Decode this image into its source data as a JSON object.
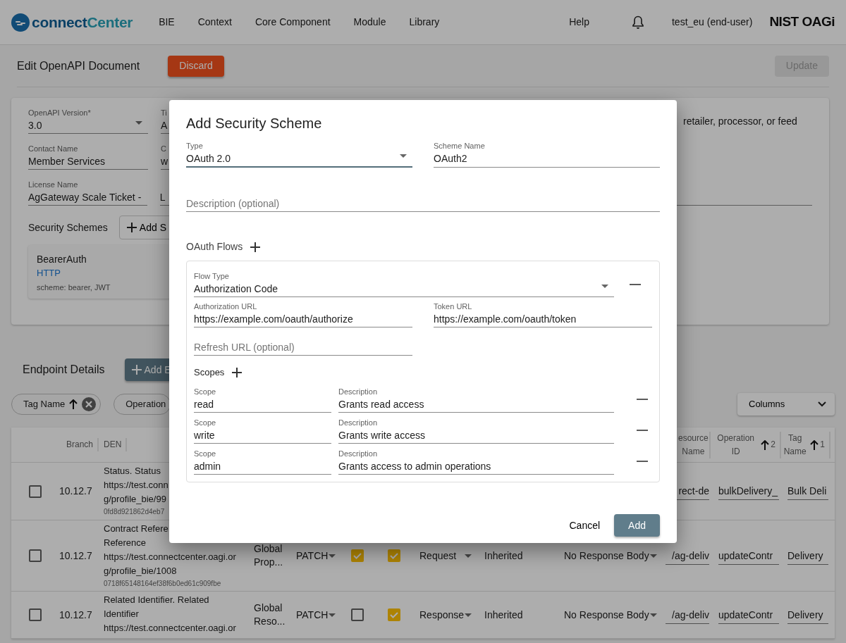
{
  "navbar": {
    "brand": {
      "part_1": "connect",
      "part_2": "Center"
    },
    "menu": [
      {
        "label": "BIE"
      },
      {
        "label": "Context"
      },
      {
        "label": "Core Component"
      },
      {
        "label": "Module"
      },
      {
        "label": "Library"
      }
    ],
    "help": "Help",
    "user": "test_eu (end-user)",
    "org_logo": "NIST OAGi"
  },
  "toolbar": {
    "title": "Edit OpenAPI Document",
    "discard_button": "Discard",
    "update_button": {
      "label": "Update",
      "disabled": true
    }
  },
  "document_form": {
    "rows": [
      [
        {
          "label": "OpenAPI Version*",
          "value": "3.0",
          "kind": "select"
        },
        {
          "label": "Ti",
          "value": "A",
          "kind": "text"
        }
      ],
      [
        {
          "label": "Contact Name",
          "value": "Member Services",
          "kind": "text"
        },
        {
          "label": "C",
          "value": "w",
          "kind": "text"
        }
      ],
      [
        {
          "label": "License Name",
          "value": "AgGateway Scale Ticket -",
          "kind": "text"
        },
        {
          "value": "L",
          "kind": "text"
        }
      ]
    ],
    "description_excerpt": "retailer, processor, or feed"
  },
  "security_schemes": {
    "label": "Security Schemes",
    "add_button": "Add S",
    "schemes": [
      {
        "name": "BearerAuth",
        "type": "HTTP",
        "details": "scheme: bearer, JWT"
      }
    ]
  },
  "endpoints": {
    "title": "Endpoint Details",
    "add_button": "Add E",
    "sort_chips": [
      {
        "label": "Tag Name",
        "ascending": true,
        "removable": true
      },
      {
        "label": "Operation"
      }
    ],
    "columns_button": "Columns",
    "table": {
      "columns": {
        "branch": {
          "label": "Branch"
        },
        "den": {
          "label": "DEN"
        },
        "resource_name": {
          "label": "esource Name"
        },
        "operation_id": {
          "label": "Operation ID",
          "ascending": true,
          "sort_order": "2"
        },
        "tag_name": {
          "label": "Tag Name",
          "ascending": true,
          "sort_order": "1"
        }
      },
      "rows": [
        {
          "selected": false,
          "branch": "10.12.7",
          "den": [
            "Status. Status",
            "https://test.conn",
            "g/profile_bie/99"
          ],
          "den_id": "0fd8d921862d4eb7",
          "resource_name": "rect-de",
          "operation_id": "bulkDelivery_",
          "tag_name": "Bulk Deli"
        },
        {
          "selected": false,
          "branch": "10.12.7",
          "den": [
            "Contract Refere",
            "Reference",
            "https://test.connectcenter.oagi.or",
            "g/profile_bie/1008"
          ],
          "den_id": "0718f65148164ef38f6b0ed61c909fbe",
          "component": "Global Prop...",
          "method": "PATCH",
          "flag_1": true,
          "flag_2": true,
          "message_type": "Request",
          "inheritance": "Inherited",
          "response_body": "No Response Body",
          "resource_name": "/ag-deliv",
          "operation_id": "updateContr",
          "tag_name": "Delivery"
        },
        {
          "selected": false,
          "branch": "10.12.7",
          "den": [
            "Related Identifier. Related",
            "Identifier",
            "https://test.connectcenter.oagi.or"
          ],
          "component": "Global Reso...",
          "method": "PATCH",
          "flag_1": false,
          "flag_2": true,
          "message_type": "Response",
          "inheritance": "Inherited",
          "response_body": "No Response Body",
          "resource_name": "/ag-deliv",
          "operation_id": "updateContr",
          "tag_name": "Delivery"
        }
      ]
    }
  },
  "dialog": {
    "title": "Add Security Scheme",
    "type": {
      "label": "Type",
      "value": "OAuth 2.0"
    },
    "scheme_name": {
      "label": "Scheme Name",
      "value": "OAuth2"
    },
    "description": {
      "placeholder": "Description (optional)"
    },
    "flows_label": "OAuth Flows",
    "flows": [
      {
        "flow_type": {
          "label": "Flow Type",
          "value": "Authorization Code"
        },
        "authorization_url": {
          "label": "Authorization URL",
          "value": "https://example.com/oauth/authorize"
        },
        "token_url": {
          "label": "Token URL",
          "value": "https://example.com/oauth/token"
        },
        "refresh_url": {
          "placeholder": "Refresh URL (optional)"
        },
        "scopes_label": "Scopes",
        "scopes": [
          {
            "scope_label": "Scope",
            "scope": "read",
            "description_label": "Description",
            "description": "Grants read access"
          },
          {
            "scope_label": "Scope",
            "scope": "write",
            "description_label": "Description",
            "description": "Grants write access"
          },
          {
            "scope_label": "Scope",
            "scope": "admin",
            "description_label": "Description",
            "description": "Grants access to admin operations"
          }
        ]
      }
    ],
    "cancel_button": "Cancel",
    "add_button": "Add"
  }
}
